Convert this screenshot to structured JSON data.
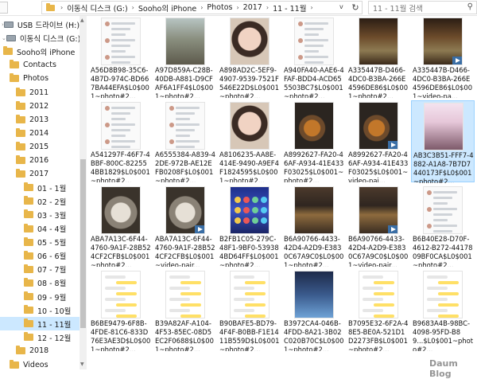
{
  "breadcrumb": [
    "이동식 디스크 (G:)",
    "Sooho의 iPhone",
    "Photos",
    "2017",
    "11 - 11월"
  ],
  "search": {
    "placeholder": "11 - 11월 검색"
  },
  "nav": [
    {
      "label": "USB 드라이브 (H:)",
      "kind": "drive",
      "indent": 0,
      "chevron": ">"
    },
    {
      "label": "이동식 디스크 (G:)",
      "kind": "drive",
      "indent": 0,
      "chevron": "v"
    },
    {
      "label": "Sooho의 iPhone",
      "kind": "folder",
      "indent": 1
    },
    {
      "label": "Contacts",
      "kind": "folder",
      "indent": 2
    },
    {
      "label": "Photos",
      "kind": "folder",
      "indent": 2
    },
    {
      "label": "2011",
      "kind": "folder",
      "indent": 3
    },
    {
      "label": "2012",
      "kind": "folder",
      "indent": 3
    },
    {
      "label": "2013",
      "kind": "folder",
      "indent": 3
    },
    {
      "label": "2014",
      "kind": "folder",
      "indent": 3
    },
    {
      "label": "2015",
      "kind": "folder",
      "indent": 3
    },
    {
      "label": "2016",
      "kind": "folder",
      "indent": 3
    },
    {
      "label": "2017",
      "kind": "folder",
      "indent": 3
    },
    {
      "label": "01 - 1월",
      "kind": "folder",
      "indent": 4
    },
    {
      "label": "02 - 2월",
      "kind": "folder",
      "indent": 4
    },
    {
      "label": "03 - 3월",
      "kind": "folder",
      "indent": 4
    },
    {
      "label": "04 - 4월",
      "kind": "folder",
      "indent": 4
    },
    {
      "label": "05 - 5월",
      "kind": "folder",
      "indent": 4
    },
    {
      "label": "06 - 6월",
      "kind": "folder",
      "indent": 4
    },
    {
      "label": "07 - 7월",
      "kind": "folder",
      "indent": 4
    },
    {
      "label": "08 - 8월",
      "kind": "folder",
      "indent": 4
    },
    {
      "label": "09 - 9월",
      "kind": "folder",
      "indent": 4
    },
    {
      "label": "10 - 10월",
      "kind": "folder",
      "indent": 4
    },
    {
      "label": "11 - 11월",
      "kind": "folder",
      "indent": 4,
      "selected": true
    },
    {
      "label": "12 - 12월",
      "kind": "folder",
      "indent": 4
    },
    {
      "label": "2018",
      "kind": "folder",
      "indent": 3
    },
    {
      "label": "Videos",
      "kind": "folder",
      "indent": 2
    }
  ],
  "files": [
    {
      "name": "A56D8B98-35C6-4B7D-974C-BD667BA44EFA$L0$001~photo#2...",
      "thumb": "t-feed"
    },
    {
      "name": "A97D859A-C28B-40DB-A881-D9CFAF6A1FF4$L0$001~photo#2...",
      "thumb": "t-photo-a"
    },
    {
      "name": "A898AD2C-5EF9-4907-9539-7521F546E22D$L0$001~photo#2...",
      "thumb": "t-selfie"
    },
    {
      "name": "A940FA40-AAE6-4FAF-BDD4-ACD655503BC7$L0$001~photo#2...",
      "thumb": "t-feed"
    },
    {
      "name": "A335447B-D466-4DC0-B3BA-266E4596DE86$L0$001~photo#2...",
      "thumb": "t-bar"
    },
    {
      "name": "A335447B-D466-4DC0-B3BA-266E4596DE86$L0$001~video-pa...",
      "thumb": "t-bar",
      "video": true
    },
    {
      "name": "A541297F-46F7-4BBF-800C-822554BB1829$L0$001~photo#2...",
      "thumb": "t-feed"
    },
    {
      "name": "A6555384-A839-42DE-972B-AE12EFB0208F$L0$001~photo#2...",
      "thumb": "t-feed"
    },
    {
      "name": "A8106235-AA8E-414E-9490-A9EF4F1824595$L0$001~photo#2...",
      "thumb": "t-selfie"
    },
    {
      "name": "A8992627-FA20-46AF-A934-41E433F03025$L0$001~photo#2...",
      "thumb": "t-food"
    },
    {
      "name": "A8992627-FA20-46AF-A934-41E433F03025$L0$001~video-pai...",
      "thumb": "t-food",
      "video": true
    },
    {
      "name": "AB3C3B51-FFF7-4882-A1A8-7B7D7440173F$L0$001~photo#2...",
      "thumb": "t-call",
      "selected": true
    },
    {
      "name": "ABA7A13C-6F44-4760-9A1F-28B524CF2CFB$L0$001~photo#2...",
      "thumb": "t-cat"
    },
    {
      "name": "ABA7A13C-6F44-4760-9A1F-28B524CF2CFB$L0$001~video-pair...",
      "thumb": "t-cat",
      "video": true
    },
    {
      "name": "B2FB1C05-279C-48F1-9BF0-539384BD64FF$L0$001~photo#2...",
      "thumb": "t-game"
    },
    {
      "name": "B6A90766-4433-42D4-A2D9-E3830C67A9C0$L0$001~photo#2...",
      "thumb": "t-table"
    },
    {
      "name": "B6A90766-4433-42D4-A2D9-E3830C67A9C0$L0$001~video-pair...",
      "thumb": "t-table",
      "video": true
    },
    {
      "name": "B6B40E28-D70F-4612-B272-4417809BF0CA$L0$001~photo#2...",
      "thumb": "t-feed"
    },
    {
      "name": "B6BE9479-6F8B-4FDE-81C6-833D76E3AE3D$L0$001~photo#2...",
      "thumb": "t-chat"
    },
    {
      "name": "B39A82AF-A104-4F53-85EC-08D5EC2F0688$L0$001~photo#2...",
      "thumb": "t-chat"
    },
    {
      "name": "B90BAFE5-BD79-4F4F-B0BB-F1E1411B559D$L0$001~photo#2...",
      "thumb": "t-chat"
    },
    {
      "name": "B3972CA4-046B-4FDD-8A21-3B02C020B70C$L0$001~photo#2...",
      "thumb": "t-lock"
    },
    {
      "name": "B7095E32-6F2A-48E5-BE0A-521D1D2273FB$L0$001~photo#2...",
      "thumb": "t-chat"
    },
    {
      "name": "B9683A4B-98BC-4098-95FD-B89...$L0$001~photo#2...",
      "thumb": "t-chat"
    }
  ],
  "watermark": "Daum Blog"
}
